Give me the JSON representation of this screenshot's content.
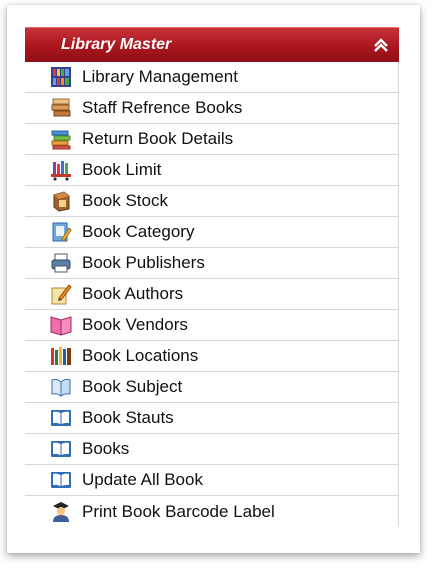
{
  "panel": {
    "title": "Library Master",
    "collapse_icon": "double-chevron-up-icon",
    "header_color": "#a9161d"
  },
  "menu": {
    "items": [
      {
        "label": "Library Management",
        "icon": "bookshelf-icon"
      },
      {
        "label": "Staff Refrence Books",
        "icon": "book-stack-icon"
      },
      {
        "label": "Return Book Details",
        "icon": "books-pile-icon"
      },
      {
        "label": "Book Limit",
        "icon": "books-on-cart-icon"
      },
      {
        "label": "Book Stock",
        "icon": "book-box-icon"
      },
      {
        "label": "Book Category",
        "icon": "book-edit-icon"
      },
      {
        "label": "Book Publishers",
        "icon": "printer-icon"
      },
      {
        "label": "Book Authors",
        "icon": "pen-notepad-icon"
      },
      {
        "label": "Book Vendors",
        "icon": "pink-book-icon"
      },
      {
        "label": "Book Locations",
        "icon": "shelf-books-icon"
      },
      {
        "label": "Book Subject",
        "icon": "open-book-icon"
      },
      {
        "label": "Book Stauts",
        "icon": "open-book-blue-icon"
      },
      {
        "label": "Books",
        "icon": "open-book-blue-icon"
      },
      {
        "label": "Update All Book",
        "icon": "open-book-blue-icon"
      },
      {
        "label": "Print Book Barcode Label",
        "icon": "graduate-user-icon"
      }
    ]
  }
}
